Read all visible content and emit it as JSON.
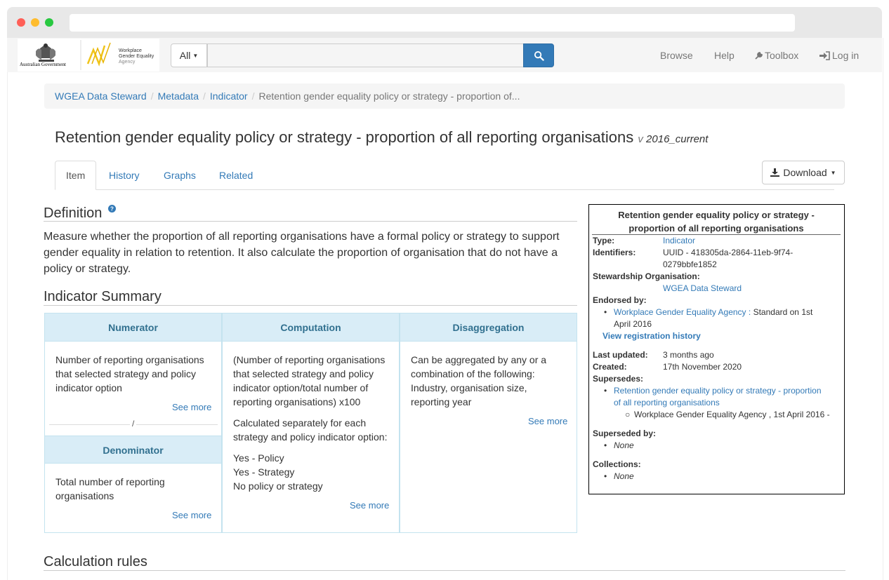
{
  "window": {
    "traffic_lights": [
      "#ff5f57",
      "#febc2e",
      "#28c840"
    ]
  },
  "navbar": {
    "logos": {
      "gov_label": "Australian Government",
      "agency_line1": "Workplace",
      "agency_line2": "Gender Equality",
      "agency_line3": "Agency"
    },
    "search": {
      "scope": "All",
      "placeholder": "",
      "button_icon": "search-icon"
    },
    "links": [
      "Browse",
      "Help",
      "Toolbox",
      "Log in"
    ]
  },
  "breadcrumb": [
    "WGEA Data Steward",
    "Metadata",
    "Indicator",
    "Retention gender equality policy or strategy - proportion of..."
  ],
  "page": {
    "title": "Retention gender equality policy or strategy - proportion of all reporting organisations",
    "version_prefix": "v",
    "version": "2016_current"
  },
  "tabs": [
    "Item",
    "History",
    "Graphs",
    "Related"
  ],
  "download_label": "Download",
  "definition": {
    "heading": "Definition",
    "help_icon": "help-icon",
    "text": "Measure whether the proportion of all reporting organisations have a formal policy or strategy to support gender equality in relation to retention. It also calculate the proportion of organisation that do not have a policy or strategy."
  },
  "summary": {
    "heading": "Indicator Summary",
    "numerator": {
      "head": "Numerator",
      "text": "Number of reporting organisations that selected strategy and policy indicator option",
      "see_more": "See more"
    },
    "divider": "/",
    "denominator": {
      "head": "Denominator",
      "text": "Total number of reporting organisations",
      "see_more": "See more"
    },
    "computation": {
      "head": "Computation",
      "p1": "(Number of reporting organisations that selected strategy and policy indicator option/total number of reporting organisations) x100",
      "p2": "Calculated separately for each strategy and policy indicator option:",
      "options": [
        "Yes - Policy",
        "Yes - Strategy",
        "No policy or strategy"
      ],
      "see_more": "See more"
    },
    "disaggregation": {
      "head": "Disaggregation",
      "text": "Can be aggregated by any or a combination of the following: Industry, organisation size, reporting year",
      "see_more": "See more"
    }
  },
  "calc_rules_heading": "Calculation rules",
  "infobox": {
    "title": "Retention gender equality policy or strategy - proportion of all reporting organisations",
    "type_label": "Type:",
    "type_value": "Indicator",
    "identifiers_label": "Identifiers:",
    "identifiers_line1": "UUID - 418305da-2864-11eb-9f74-",
    "identifiers_line2": "0279bbfe1852",
    "steward_label": "Stewardship Organisation:",
    "steward_value": "WGEA Data Steward",
    "endorsed_label": "Endorsed by:",
    "endorsed_org": "Workplace Gender Equality Agency",
    "endorsed_colon": ":",
    "endorsed_status": "Standard on 1st",
    "endorsed_date": "April 2016",
    "reg_history": "View registration history",
    "updated_label": "Last updated:",
    "updated_value": "3 months ago",
    "created_label": "Created:",
    "created_value": "17th November 2020",
    "supersedes_label": "Supersedes:",
    "supersedes_line1": "Retention gender equality policy or strategy - proportion",
    "supersedes_line2": "of all reporting organisations",
    "supersedes_sub": "Workplace Gender Equality Agency , 1st April 2016 -",
    "superseded_label": "Superseded by:",
    "superseded_value": "None",
    "collections_label": "Collections:",
    "collections_value": "None"
  }
}
